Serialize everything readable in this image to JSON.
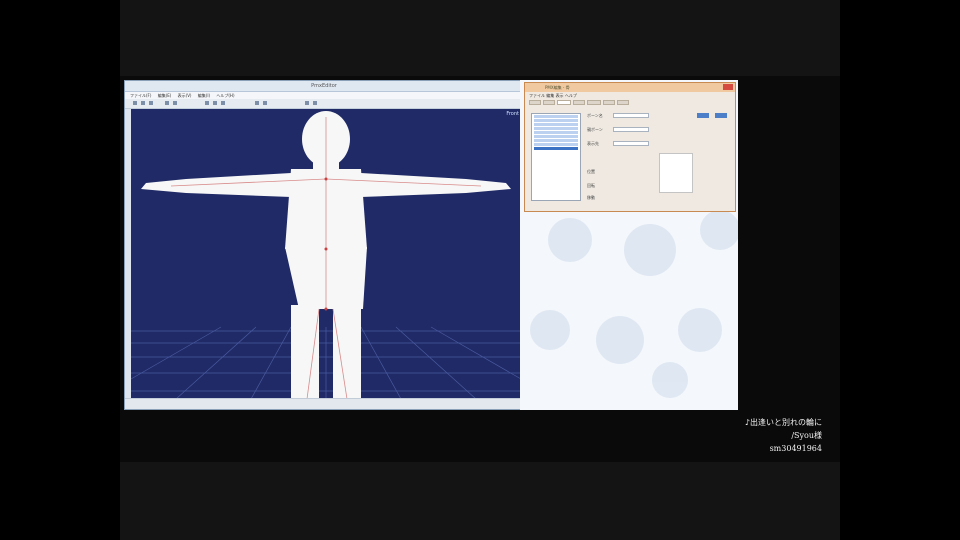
{
  "editor": {
    "title": "PmxEditor",
    "menu": [
      "ファイル(F)",
      "編集(E)",
      "表示(V)",
      "編集(I)",
      "ヘルプ(H)"
    ],
    "view_label": "Front"
  },
  "bone_dialog": {
    "title": "PMX編集 - 骨",
    "menu": [
      "ファイル",
      "編集",
      "表示",
      "ヘルプ"
    ],
    "tabs": [
      "頂点",
      "材質",
      "ボーン",
      "モーフ",
      "表示枠",
      "剛体",
      "Joint"
    ],
    "fields": [
      "ボーン名",
      "親ボーン",
      "表示先",
      "位置",
      "回転",
      "移動"
    ]
  },
  "caption": {
    "line1": "♪出逢いと別れの輪に",
    "line2": "/Syou様",
    "line3": "sm30491964"
  }
}
